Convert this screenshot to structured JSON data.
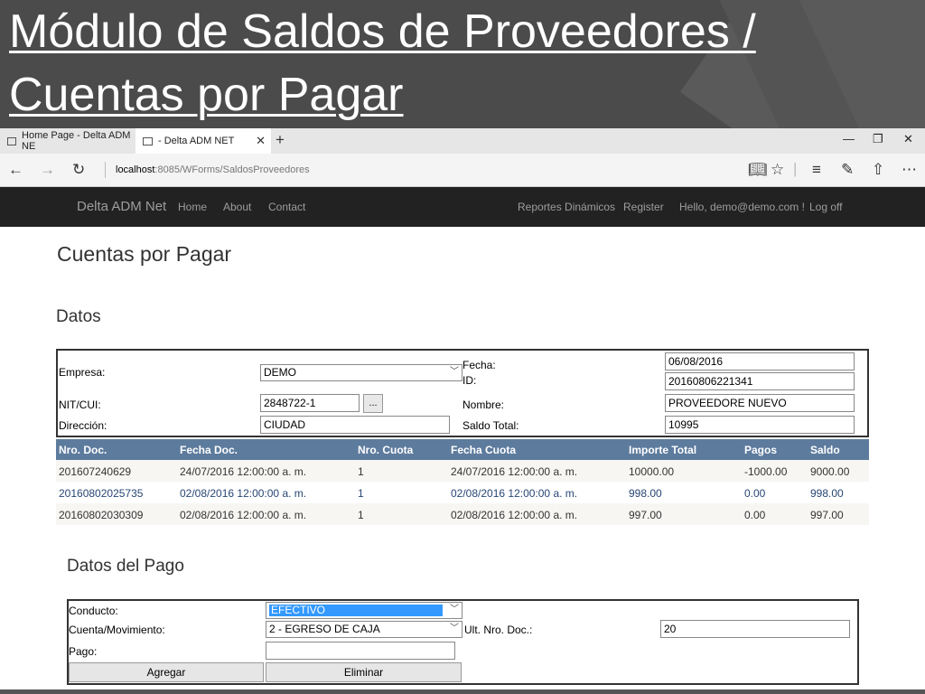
{
  "slide": {
    "title_line1": "Módulo de Saldos de Proveedores /",
    "title_line2": "Cuentas por Pagar"
  },
  "browser": {
    "tabs": [
      {
        "label": "Home Page - Delta ADM NE"
      },
      {
        "label": "- Delta ADM NET"
      }
    ],
    "url_host": "localhost",
    "url_path": ":8085/WForms/SaldosProveedores"
  },
  "navbar": {
    "brand": "Delta ADM Net",
    "links": [
      "Home",
      "About",
      "Contact"
    ],
    "right_links": [
      "Reportes Dinámicos",
      "Register",
      "Hello, demo@demo.com !",
      "Log off"
    ]
  },
  "page": {
    "heading": "Cuentas por Pagar",
    "datos_heading": "Datos",
    "pago_heading": "Datos del Pago"
  },
  "datos": {
    "empresa_label": "Empresa:",
    "empresa_value": "DEMO",
    "fecha_label": "Fecha:",
    "fecha_value": "06/08/2016",
    "id_label": "ID:",
    "id_value": "20160806221341",
    "nit_label": "NIT/CUI:",
    "nit_value": "2848722-1",
    "search_button": "...",
    "nombre_label": "Nombre:",
    "nombre_value": "PROVEEDORE NUEVO",
    "direccion_label": "Dirección:",
    "direccion_value": "CIUDAD",
    "saldo_label": "Saldo Total:",
    "saldo_value": "10995"
  },
  "grid": {
    "headers": [
      "Nro. Doc.",
      "Fecha Doc.",
      "Nro. Cuota",
      "Fecha Cuota",
      "Importe Total",
      "Pagos",
      "Saldo"
    ],
    "rows": [
      [
        "201607240629",
        "24/07/2016 12:00:00 a. m.",
        "1",
        "24/07/2016 12:00:00 a. m.",
        "10000.00",
        "-1000.00",
        "9000.00"
      ],
      [
        "20160802025735",
        "02/08/2016 12:00:00 a. m.",
        "1",
        "02/08/2016 12:00:00 a. m.",
        "998.00",
        "0.00",
        "998.00"
      ],
      [
        "20160802030309",
        "02/08/2016 12:00:00 a. m.",
        "1",
        "02/08/2016 12:00:00 a. m.",
        "997.00",
        "0.00",
        "997.00"
      ]
    ]
  },
  "pago": {
    "conducto_label": "Conducto:",
    "conducto_value": "EFECTIVO",
    "cuenta_label": "Cuenta/Movimiento:",
    "cuenta_value": "2 - EGRESO DE CAJA",
    "ult_label": "Ult. Nro. Doc.:",
    "ult_value": "20",
    "pago_label": "Pago:",
    "pago_value": "",
    "agregar_button": "Agregar",
    "eliminar_button": "Eliminar"
  },
  "colors": {
    "grid_header": "#5d7b9d",
    "navbar": "#222222",
    "selection": "#3399ff"
  }
}
